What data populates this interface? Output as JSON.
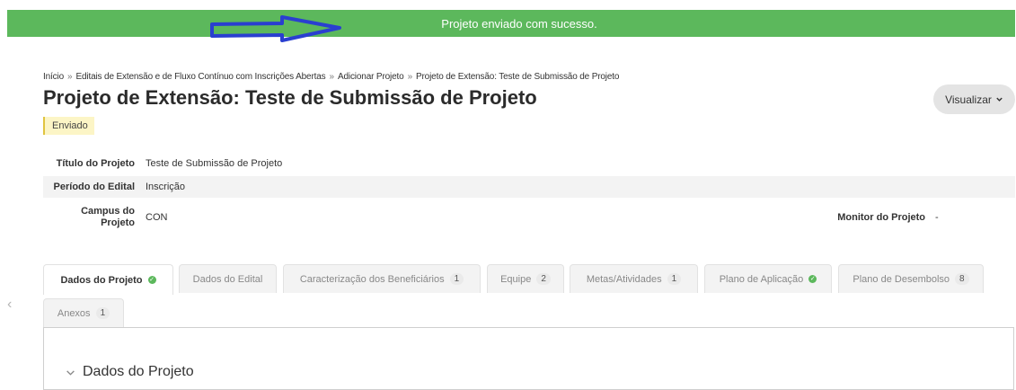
{
  "alert": {
    "message": "Projeto enviado com sucesso."
  },
  "breadcrumb": [
    "Início",
    "Editais de Extensão e de Fluxo Contínuo com Inscrições Abertas",
    "Adicionar Projeto",
    "Projeto de Extensão: Teste de Submissão de Projeto"
  ],
  "breadcrumb_separator": "»",
  "page": {
    "title": "Projeto de Extensão: Teste de Submissão de Projeto",
    "status": "Enviado",
    "view_button": "Visualizar"
  },
  "details": {
    "titulo_label": "Título do Projeto",
    "titulo_value": "Teste de Submissão de Projeto",
    "periodo_label": "Período do Edital",
    "periodo_value": "Inscrição",
    "campus_label_line1": "Campus do",
    "campus_label_line2": "Projeto",
    "campus_value": "CON",
    "monitor_label": "Monitor do Projeto",
    "monitor_value": "-"
  },
  "tabs": [
    {
      "label": "Dados do Projeto",
      "active": true,
      "complete": true
    },
    {
      "label": "Dados do Edital"
    },
    {
      "label": "Caracterização dos Beneficiários",
      "count": "1"
    },
    {
      "label": "Equipe",
      "count": "2"
    },
    {
      "label": "Metas/Atividades",
      "count": "1"
    },
    {
      "label": "Plano de Aplicação",
      "complete": true
    },
    {
      "label": "Plano de Desembolso",
      "count": "8"
    },
    {
      "label": "Anexos",
      "count": "1"
    }
  ],
  "section": {
    "title": "Dados do Projeto"
  },
  "colors": {
    "success": "#5cb85c",
    "annotation_arrow": "#2a3fd0",
    "status_badge": "#fcf5c6"
  }
}
